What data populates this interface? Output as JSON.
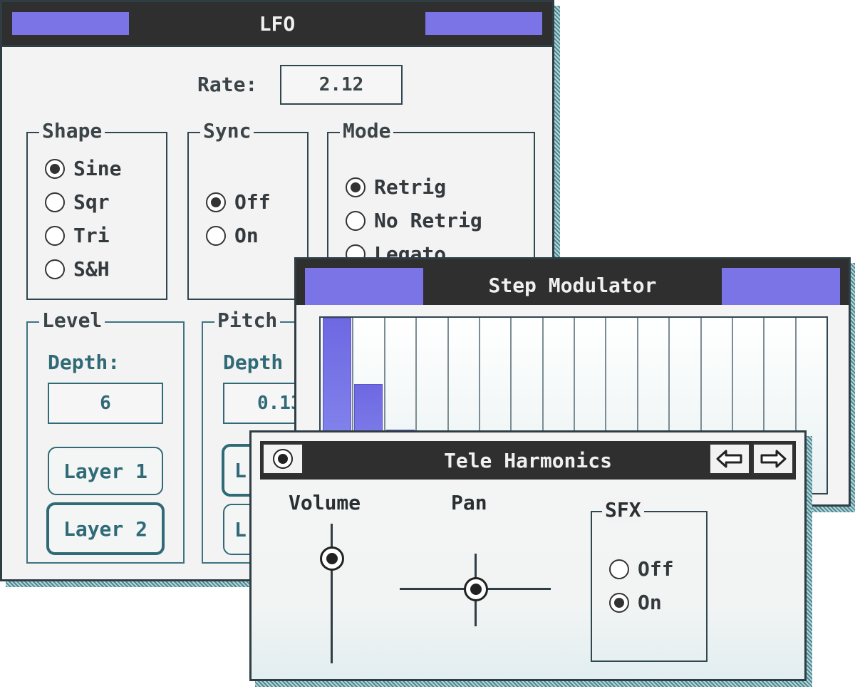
{
  "lfo": {
    "title": "LFO",
    "rate_label": "Rate:",
    "rate_value": "2.12",
    "shape": {
      "title": "Shape",
      "options": [
        "Sine",
        "Sqr",
        "Tri",
        "S&H"
      ],
      "selected": "Sine"
    },
    "sync": {
      "title": "Sync",
      "options": [
        "Off",
        "On"
      ],
      "selected": "Off"
    },
    "mode": {
      "title": "Mode",
      "options": [
        "Retrig",
        "No Retrig",
        "Legato"
      ],
      "selected": "Retrig"
    },
    "level": {
      "title": "Level",
      "depth_label": "Depth:",
      "depth_value": "6",
      "buttons": [
        "Layer 1",
        "Layer 2"
      ]
    },
    "pitch": {
      "title": "Pitch",
      "depth_label": "Depth",
      "depth_value": "0.13",
      "button_label_1": "L",
      "button_label_2": "L"
    }
  },
  "step_modulator": {
    "title": "Step Modulator",
    "step_count": 16,
    "visible_bar_levels": [
      1.0,
      0.62,
      0.36
    ]
  },
  "tele_harmonics": {
    "title": "Tele Harmonics",
    "volume_label": "Volume",
    "pan_label": "Pan",
    "sfx": {
      "title": "SFX",
      "options": [
        "Off",
        "On"
      ],
      "selected": "On"
    },
    "icons": {
      "close": "radio-close-icon",
      "back": "arrow-left-icon",
      "forward": "arrow-right-icon"
    }
  },
  "colors": {
    "accent": "#7b74e6",
    "titlebar": "#2f2f2f",
    "teal": "#2f6a76"
  }
}
